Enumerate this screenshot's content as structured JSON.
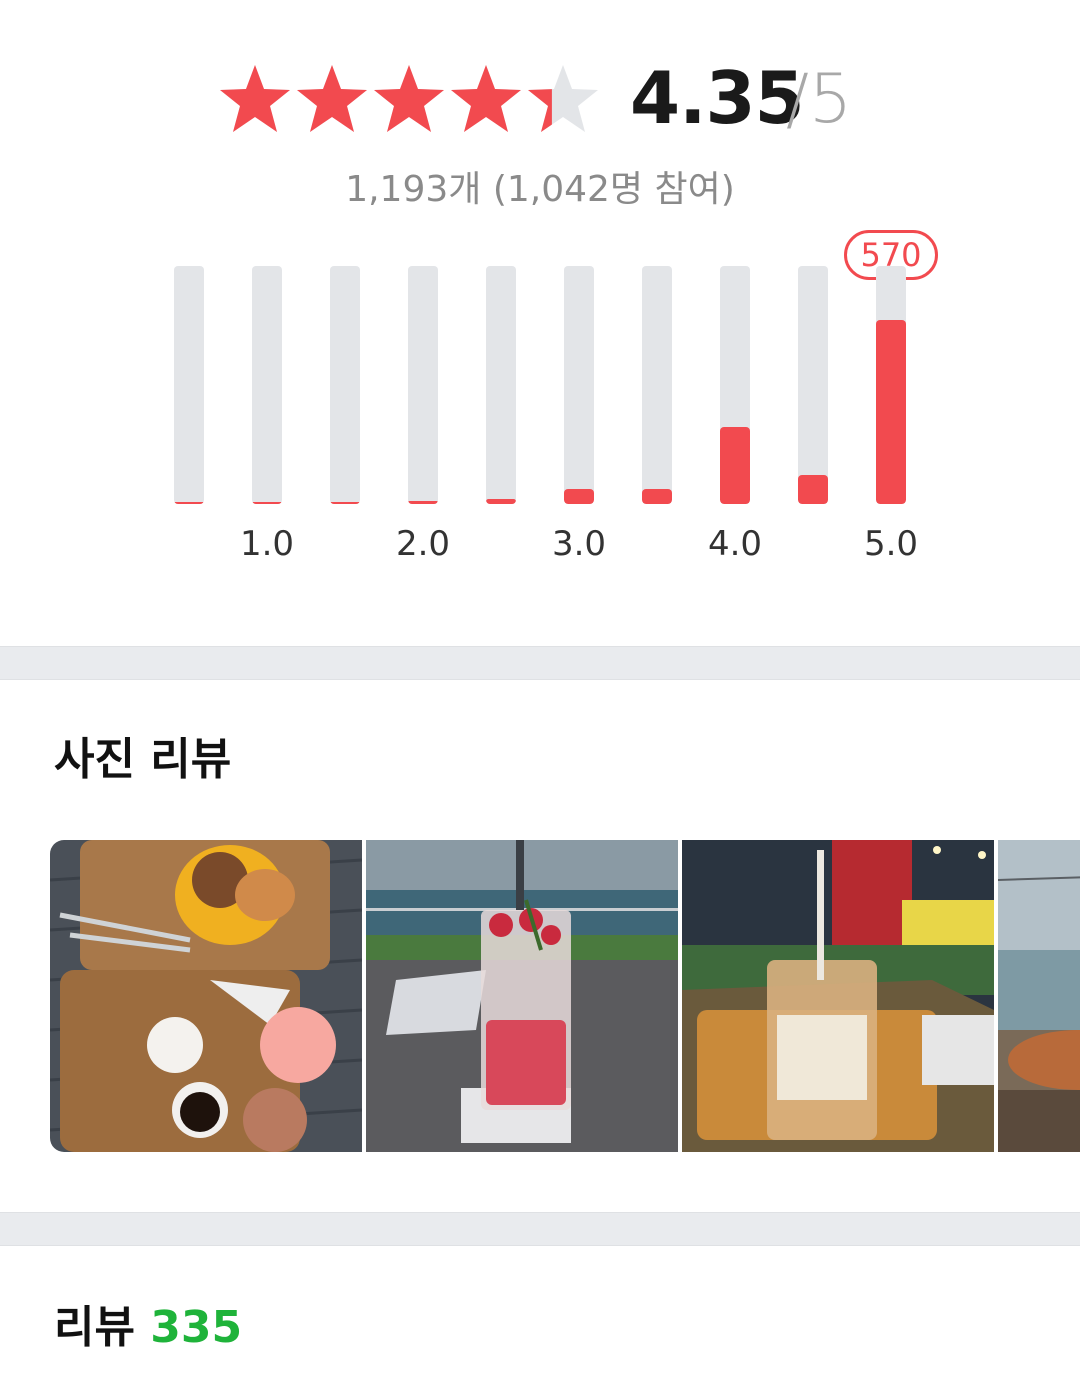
{
  "rating": {
    "score": "4.35",
    "max": "/5",
    "value": 4.35,
    "star_count": 5,
    "summary": "1,193개 (1,042명 참여)"
  },
  "histogram": {
    "bins": [
      {
        "score": 0.5,
        "count": 2
      },
      {
        "score": 1.0,
        "count": 3
      },
      {
        "score": 1.5,
        "count": 1
      },
      {
        "score": 2.0,
        "count": 8
      },
      {
        "score": 2.5,
        "count": 14
      },
      {
        "score": 3.0,
        "count": 48
      },
      {
        "score": 3.5,
        "count": 45
      },
      {
        "score": 4.0,
        "count": 238
      },
      {
        "score": 4.5,
        "count": 90
      },
      {
        "score": 5.0,
        "count": 570
      }
    ],
    "tick_labels": [
      "1.0",
      "2.0",
      "3.0",
      "4.0",
      "5.0"
    ],
    "highlight_label": "570",
    "colors": {
      "fill": "#f24a4f",
      "track": "#e3e5e8"
    }
  },
  "photo_review": {
    "title": "사진 리뷰",
    "photos": [
      "bakery-tray-photo",
      "strawberry-soda-photo",
      "night-drink-photo",
      "seaside-pastry-photo"
    ]
  },
  "reviews": {
    "title": "리뷰",
    "count": "335"
  },
  "colors": {
    "accent_red": "#f24a4f",
    "accent_green": "#1fb33a",
    "star_empty": "#e3e5e8"
  }
}
